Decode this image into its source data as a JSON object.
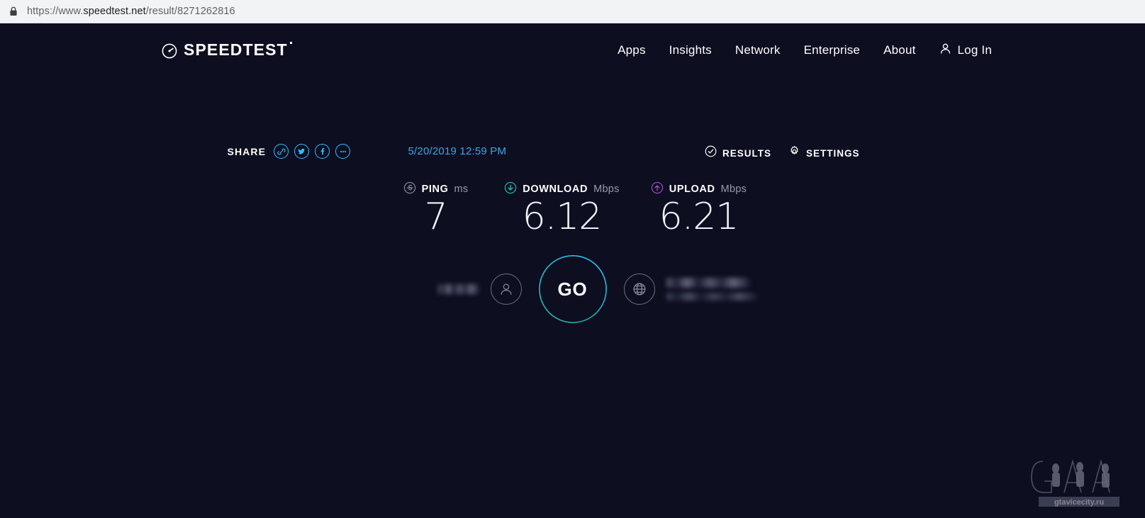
{
  "browser": {
    "lock_icon": "lock-icon",
    "url_scheme": "https://www.",
    "url_host": "speedtest.net",
    "url_path": "/result/8271262816",
    "url_full": "https://www.speedtest.net/result/8271262816"
  },
  "header": {
    "logo_icon": "speedometer-icon",
    "logo_text": "SPEEDTEST",
    "nav": [
      {
        "label": "Apps"
      },
      {
        "label": "Insights"
      },
      {
        "label": "Network"
      },
      {
        "label": "Enterprise"
      },
      {
        "label": "About"
      }
    ],
    "login": {
      "icon": "person-icon",
      "label": "Log In"
    }
  },
  "result": {
    "share": {
      "label": "SHARE",
      "buttons": [
        {
          "icon": "link-icon",
          "name": "copy-link"
        },
        {
          "icon": "twitter-icon",
          "name": "twitter"
        },
        {
          "icon": "facebook-icon",
          "name": "facebook"
        },
        {
          "icon": "ellipsis-icon",
          "name": "more"
        }
      ]
    },
    "timestamp": "5/20/2019 12:59 PM",
    "actions": [
      {
        "icon": "check-circle-icon",
        "label": "RESULTS"
      },
      {
        "icon": "gear-icon",
        "label": "SETTINGS"
      }
    ],
    "metrics": [
      {
        "key": "ping",
        "icon": "ping-icon",
        "name": "PING",
        "unit": "ms",
        "value": "7",
        "color": "#8e90a6"
      },
      {
        "key": "download",
        "icon": "download-arrow-icon",
        "name": "DOWNLOAD",
        "unit": "Mbps",
        "value": "6.12",
        "color": "#1fc7b4"
      },
      {
        "key": "upload",
        "icon": "upload-arrow-icon",
        "name": "UPLOAD",
        "unit": "Mbps",
        "value": "6.21",
        "color": "#a64fd6"
      }
    ],
    "go_button": {
      "label": "GO",
      "ring_color": "#22c1d6"
    },
    "connection": {
      "client": {
        "icon": "person-icon",
        "isp_blurred": true,
        "isp_text": ""
      },
      "server": {
        "icon": "globe-icon",
        "blurred": true,
        "name_text": "",
        "location_text": ""
      }
    }
  },
  "watermark": {
    "name": "gtavicecity-watermark",
    "text": "gtavicecity.ru"
  },
  "colors": {
    "page_background": "#0d0e20",
    "browser_bar": "#f1f3f4",
    "accent_cyan": "#2ec1ff",
    "accent_teal": "#1fc7b4",
    "accent_purple": "#a64fd6",
    "date_blue": "#3ba7e8"
  }
}
